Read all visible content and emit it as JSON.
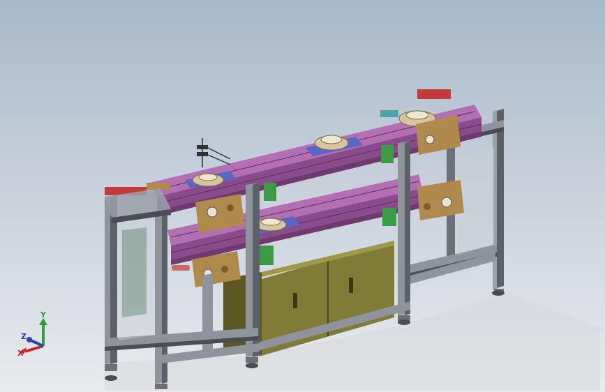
{
  "viewport": {
    "background_top": "#a9b9cb",
    "background_bottom": "#e9ebee"
  },
  "model": {
    "frame_color": "#8f949c",
    "frame_dark": "#4a4d53",
    "rail_color": "#a25fa0",
    "rail_dark": "#6e3a70",
    "cabinet_color": "#7f7a35",
    "cabinet_dark": "#5b5824",
    "accent_green": "#3c9a44",
    "accent_red": "#c23a3a",
    "accent_blue": "#5a66c6",
    "bracket_color": "#b08a4c",
    "feet_color": "#6e7076"
  },
  "triad": {
    "x_label": "X",
    "y_label": "Y",
    "z_label": "Z",
    "x_color": "#c62828",
    "y_color": "#2e9d3a",
    "z_color": "#2f3fb5"
  }
}
